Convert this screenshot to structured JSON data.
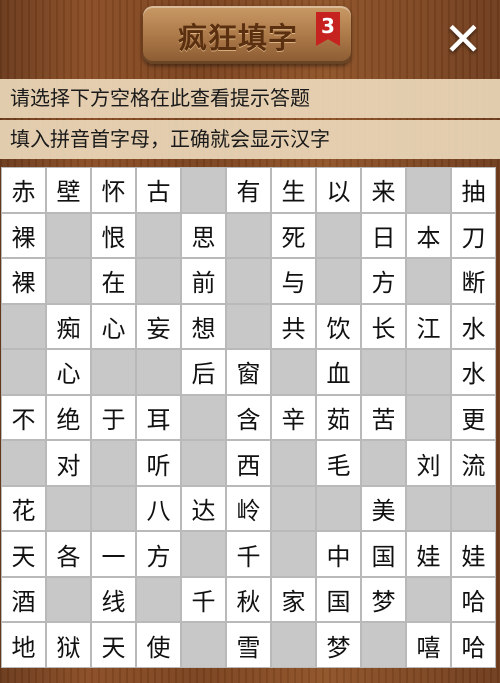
{
  "header": {
    "title": "疯狂填字",
    "level": "3",
    "close_symbol": "✕"
  },
  "hints": {
    "line1": "请选择下方空格在此查看提示答题",
    "line2": "填入拼音首字母，正确就会显示汉字"
  },
  "grid": [
    [
      "赤",
      "壁",
      "怀",
      "古",
      "",
      "有",
      "生",
      "以",
      "来",
      "",
      "抽"
    ],
    [
      "裸",
      "",
      "恨",
      "",
      "思",
      "",
      "死",
      "",
      "日",
      "本",
      "刀"
    ],
    [
      "裸",
      "",
      "在",
      "",
      "前",
      "",
      "与",
      "",
      "方",
      "",
      "断"
    ],
    [
      "",
      "痴",
      "心",
      "妄",
      "想",
      "",
      "共",
      "饮",
      "长",
      "江",
      "水"
    ],
    [
      "",
      "心",
      "",
      "",
      "后",
      "窗",
      "",
      "血",
      "",
      "",
      "水"
    ],
    [
      "不",
      "绝",
      "于",
      "耳",
      "",
      "含",
      "辛",
      "茹",
      "苦",
      "",
      "更"
    ],
    [
      "",
      "对",
      "",
      "听",
      "",
      "西",
      "",
      "毛",
      "",
      "刘",
      "流"
    ],
    [
      "花",
      "",
      "",
      "八",
      "达",
      "岭",
      "",
      "",
      "美",
      "",
      ""
    ],
    [
      "天",
      "各",
      "一",
      "方",
      "",
      "千",
      "",
      "中",
      "国",
      "娃",
      "娃"
    ],
    [
      "酒",
      "",
      "线",
      "",
      "千",
      "秋",
      "家",
      "国",
      "梦",
      "",
      "哈"
    ],
    [
      "地",
      "狱",
      "天",
      "使",
      "",
      "雪",
      "",
      "梦",
      "",
      "嘻",
      "哈"
    ]
  ]
}
